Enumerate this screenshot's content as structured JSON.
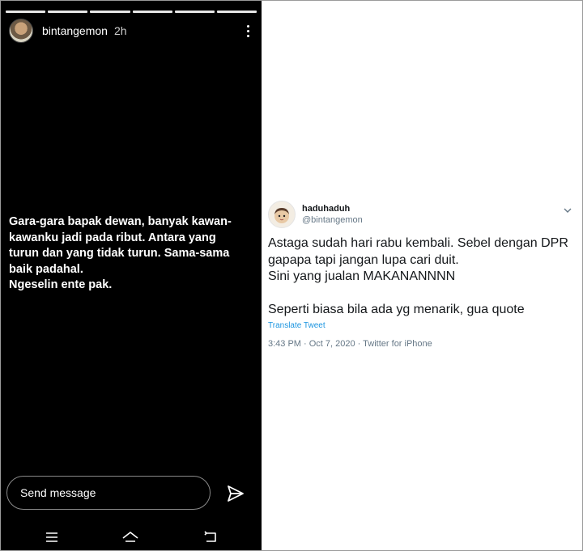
{
  "story": {
    "username": "bintangemon",
    "time": "2h",
    "progress_segments": 6,
    "text_lines": [
      "Gara-gara bapak dewan, banyak kawan-",
      "kawanku jadi pada ribut. Antara yang",
      "turun dan yang tidak turun. Sama-sama",
      "baik padahal.",
      "Ngeselin ente pak."
    ],
    "reply_placeholder": "Send message",
    "icons": {
      "more": "more-vertical-icon",
      "send": "paper-plane-icon",
      "nav_menu": "menu-icon",
      "nav_home": "home-icon",
      "nav_back": "back-icon"
    }
  },
  "tweet": {
    "display_name": "haduhaduh",
    "handle": "@bintangemon",
    "body_lines": [
      "Astaga sudah hari rabu kembali. Sebel dengan DPR",
      "gapapa tapi jangan lupa cari duit.",
      "Sini yang jualan MAKANANNNN",
      "",
      "Seperti biasa bila ada yg menarik, gua quote"
    ],
    "translate_label": "Translate Tweet",
    "meta": "3:43 PM · Oct 7, 2020 · Twitter for iPhone",
    "colors": {
      "link": "#1b95e0",
      "text": "#14171a",
      "muted": "#657786"
    }
  }
}
